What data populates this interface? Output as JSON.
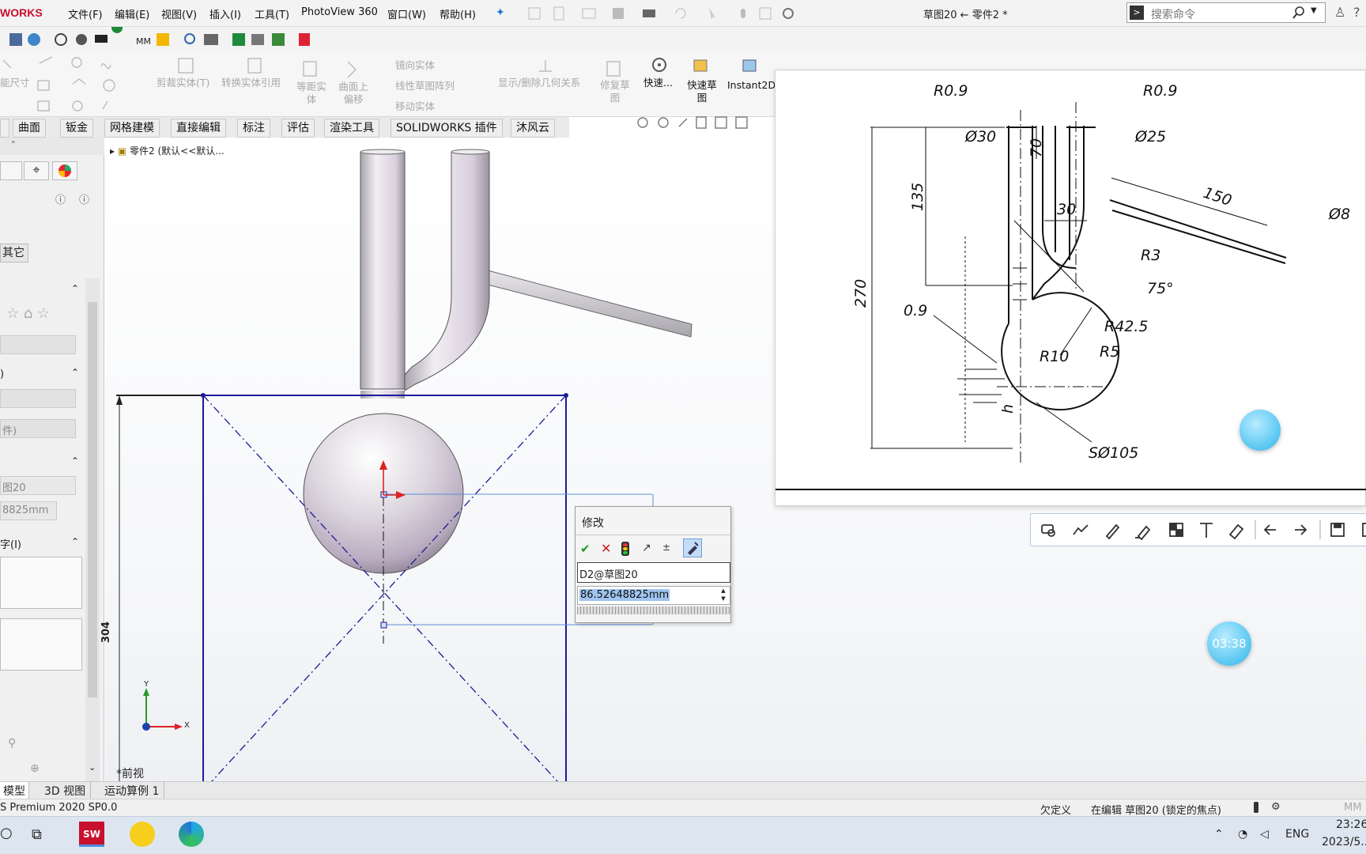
{
  "app": {
    "logo": "WORKS",
    "window_title": "草图20 ← 零件2 *",
    "search_placeholder": "搜索命令"
  },
  "menu": [
    "文件(F)",
    "编辑(E)",
    "视图(V)",
    "插入(I)",
    "工具(T)",
    "PhotoView 360",
    "窗口(W)",
    "帮助(H)"
  ],
  "ribbon": {
    "labels": [
      "能尺寸",
      "剪裁实体(T)",
      "转换实体引用",
      "等距实体",
      "曲面上偏移",
      "镜向实体",
      "线性草图阵列",
      "移动实体",
      "显示/删除几何关系",
      "修复草图",
      "快速...",
      "快速草图",
      "Instant2D"
    ]
  },
  "tabs": [
    "曲面",
    "钣金",
    "网格建模",
    "直接编辑",
    "标注",
    "评估",
    "渲染工具",
    "SOLIDWORKS 插件",
    "沐风云"
  ],
  "feature_tree": {
    "part": "零件2 (默认<<默认..."
  },
  "left_panel": {
    "tab_other": "其它",
    "sketch_name": "图20",
    "dim_value": "8825mm",
    "dropdown_partial": "件)",
    "section_text": "字(I)"
  },
  "viewport": {
    "dim_304": "304",
    "view_label": "*前视",
    "axis_x": "X",
    "axis_y": "Y"
  },
  "modify_dialog": {
    "title": "修改",
    "name_value": "D2@草图20",
    "dim_value": "86.52648825mm"
  },
  "drawing": {
    "labels": [
      "R0.9",
      "R0.9",
      "Ø30",
      "Ø25",
      "70",
      "135",
      "30",
      "150",
      "Ø8",
      "270",
      "R3",
      "75°",
      "0.9",
      "R42.5",
      "R10",
      "R5",
      "h",
      "SØ105"
    ]
  },
  "bubbles": {
    "timer": "03:38"
  },
  "bottom_tabs": [
    "模型",
    "3D 视图",
    "运动算例 1"
  ],
  "status": {
    "version": "S Premium 2020 SP0.0",
    "state": "欠定义",
    "editing": "在编辑 草图20 (锁定的焦点)",
    "unit": "MM"
  },
  "taskbar": {
    "lang": "ENG",
    "time": "23:26",
    "date": "2023/5..."
  },
  "colors": {
    "accent": "#1e73d8",
    "logo": "#c8102e",
    "sketch": "#1a1a9c"
  }
}
